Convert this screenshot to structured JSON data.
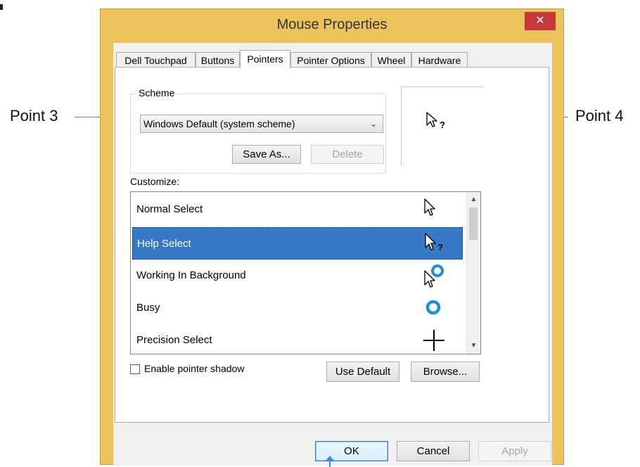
{
  "window": {
    "title": "Mouse Properties",
    "close_glyph": "✕"
  },
  "tabs": [
    {
      "label": "Dell Touchpad"
    },
    {
      "label": "Buttons"
    },
    {
      "label": "Pointers"
    },
    {
      "label": "Pointer Options"
    },
    {
      "label": "Wheel"
    },
    {
      "label": "Hardware"
    }
  ],
  "scheme": {
    "legend": "Scheme",
    "selected_value": "Windows Default (system scheme)",
    "save_as_label": "Save As...",
    "delete_label": "Delete"
  },
  "customize": {
    "label": "Customize:",
    "items": [
      {
        "label": "Normal Select",
        "icon": "arrow-cursor-icon"
      },
      {
        "label": "Help Select",
        "icon": "help-cursor-icon"
      },
      {
        "label": "Working In Background",
        "icon": "working-cursor-icon"
      },
      {
        "label": "Busy",
        "icon": "busy-ring-icon"
      },
      {
        "label": "Precision Select",
        "icon": "crosshair-icon"
      }
    ],
    "selected_index": 1
  },
  "options": {
    "shadow_label": "Enable pointer shadow",
    "shadow_checked": false,
    "use_default_label": "Use Default",
    "browse_label": "Browse..."
  },
  "footer": {
    "ok_label": "OK",
    "cancel_label": "Cancel",
    "apply_label": "Apply"
  },
  "annotations": {
    "point3": "Point 3",
    "point4": "Point 4"
  },
  "colors": {
    "window_frame": "#ecc25c",
    "close_button": "#c8373a",
    "selection": "#3879c5",
    "annotation_arrow": "#4a90c8"
  }
}
